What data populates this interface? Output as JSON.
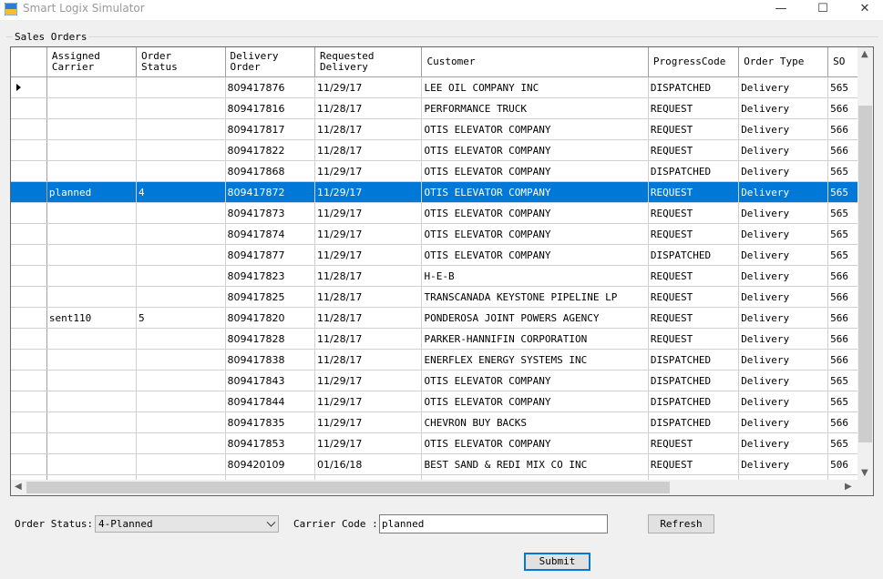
{
  "window": {
    "title": "Smart Logix Simulator",
    "minimize_glyph": "—",
    "maximize_glyph": "☐",
    "close_glyph": "✕"
  },
  "group": {
    "label": "Sales Orders"
  },
  "grid": {
    "columns": [
      "Assigned\nCarrier",
      "Order\nStatus",
      "Delivery\nOrder",
      "Requested\nDelivery",
      "Customer",
      "ProgressCode",
      "Order Type",
      "SO"
    ],
    "selected_row_index": 5,
    "current_row_index": 0,
    "rows": [
      {
        "carrier": "",
        "status": "",
        "delivery_order": "809417876",
        "requested": "11/29/17",
        "customer": "LEE OIL COMPANY INC",
        "progress": "DISPATCHED",
        "type": "Delivery",
        "so": "565"
      },
      {
        "carrier": "",
        "status": "",
        "delivery_order": "809417816",
        "requested": "11/28/17",
        "customer": "PERFORMANCE TRUCK",
        "progress": "REQUEST",
        "type": "Delivery",
        "so": "566"
      },
      {
        "carrier": "",
        "status": "",
        "delivery_order": "809417817",
        "requested": "11/28/17",
        "customer": "OTIS ELEVATOR COMPANY",
        "progress": "REQUEST",
        "type": "Delivery",
        "so": "566"
      },
      {
        "carrier": "",
        "status": "",
        "delivery_order": "809417822",
        "requested": "11/28/17",
        "customer": "OTIS ELEVATOR COMPANY",
        "progress": "REQUEST",
        "type": "Delivery",
        "so": "566"
      },
      {
        "carrier": "",
        "status": "",
        "delivery_order": "809417868",
        "requested": "11/29/17",
        "customer": "OTIS ELEVATOR COMPANY",
        "progress": "DISPATCHED",
        "type": "Delivery",
        "so": "565"
      },
      {
        "carrier": "planned",
        "status": "4",
        "delivery_order": "809417872",
        "requested": "11/29/17",
        "customer": "OTIS ELEVATOR COMPANY",
        "progress": "REQUEST",
        "type": "Delivery",
        "so": "565"
      },
      {
        "carrier": "",
        "status": "",
        "delivery_order": "809417873",
        "requested": "11/29/17",
        "customer": "OTIS ELEVATOR COMPANY",
        "progress": "REQUEST",
        "type": "Delivery",
        "so": "565"
      },
      {
        "carrier": "",
        "status": "",
        "delivery_order": "809417874",
        "requested": "11/29/17",
        "customer": "OTIS ELEVATOR COMPANY",
        "progress": "REQUEST",
        "type": "Delivery",
        "so": "565"
      },
      {
        "carrier": "",
        "status": "",
        "delivery_order": "809417877",
        "requested": "11/29/17",
        "customer": "OTIS ELEVATOR COMPANY",
        "progress": "DISPATCHED",
        "type": "Delivery",
        "so": "565"
      },
      {
        "carrier": "",
        "status": "",
        "delivery_order": "809417823",
        "requested": "11/28/17",
        "customer": "H-E-B",
        "progress": "REQUEST",
        "type": "Delivery",
        "so": "566"
      },
      {
        "carrier": "",
        "status": "",
        "delivery_order": "809417825",
        "requested": "11/28/17",
        "customer": "TRANSCANADA KEYSTONE PIPELINE LP",
        "progress": "REQUEST",
        "type": "Delivery",
        "so": "566"
      },
      {
        "carrier": "sent110",
        "status": "5",
        "delivery_order": "809417820",
        "requested": "11/28/17",
        "customer": "PONDEROSA JOINT POWERS AGENCY",
        "progress": "REQUEST",
        "type": "Delivery",
        "so": "566"
      },
      {
        "carrier": "",
        "status": "",
        "delivery_order": "809417828",
        "requested": "11/28/17",
        "customer": "PARKER-HANNIFIN CORPORATION",
        "progress": "REQUEST",
        "type": "Delivery",
        "so": "566"
      },
      {
        "carrier": "",
        "status": "",
        "delivery_order": "809417838",
        "requested": "11/28/17",
        "customer": "ENERFLEX ENERGY SYSTEMS INC",
        "progress": "DISPATCHED",
        "type": "Delivery",
        "so": "566"
      },
      {
        "carrier": "",
        "status": "",
        "delivery_order": "809417843",
        "requested": "11/29/17",
        "customer": "OTIS ELEVATOR COMPANY",
        "progress": "DISPATCHED",
        "type": "Delivery",
        "so": "565"
      },
      {
        "carrier": "",
        "status": "",
        "delivery_order": "809417844",
        "requested": "11/29/17",
        "customer": "OTIS ELEVATOR COMPANY",
        "progress": "DISPATCHED",
        "type": "Delivery",
        "so": "565"
      },
      {
        "carrier": "",
        "status": "",
        "delivery_order": "809417835",
        "requested": "11/29/17",
        "customer": "CHEVRON BUY BACKS",
        "progress": "DISPATCHED",
        "type": "Delivery",
        "so": "566"
      },
      {
        "carrier": "",
        "status": "",
        "delivery_order": "809417853",
        "requested": "11/29/17",
        "customer": "OTIS ELEVATOR COMPANY",
        "progress": "REQUEST",
        "type": "Delivery",
        "so": "565"
      },
      {
        "carrier": "",
        "status": "",
        "delivery_order": "809420109",
        "requested": "01/16/18",
        "customer": "BEST SAND & REDI MIX CO INC",
        "progress": "REQUEST",
        "type": "Delivery",
        "so": "506"
      },
      {
        "carrier": "",
        "status": "",
        "delivery_order": "",
        "requested": "",
        "customer": "",
        "progress": "",
        "type": "",
        "so": ""
      }
    ]
  },
  "form": {
    "order_status_label": "Order Status:",
    "order_status_value": "4-Planned",
    "carrier_code_label": "Carrier Code :",
    "carrier_code_value": "planned",
    "refresh_label": "Refresh",
    "submit_label": "Submit"
  },
  "colors": {
    "selection": "#0078d7",
    "window_bg": "#f0f0f0"
  },
  "icons": {
    "app": "smart-logix-app-icon",
    "row_pointer": "current-row-arrow-icon"
  }
}
